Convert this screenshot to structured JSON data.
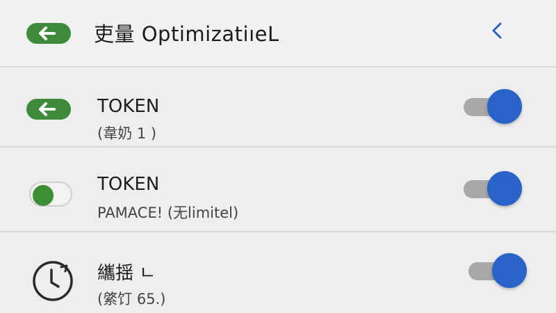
{
  "header": {
    "title": "吏量 OptimizatiıeL",
    "back_icon": "back-arrow-icon",
    "collapse_icon": "chevron-left-icon"
  },
  "rows": [
    {
      "title": "TOKEN",
      "subtitle": "(韋奶 1 )",
      "left_icon": "back-arrow-icon",
      "switch_on": true
    },
    {
      "title": "TOKEN",
      "subtitle": "PAMACE! (无limitel)",
      "left_icon": "toggle-icon",
      "switch_on": true,
      "clear_mark": "✕"
    },
    {
      "title": "纗揺 ㄴ",
      "subtitle": "(綮饤 65.)",
      "left_icon": "clock-icon",
      "switch_on": true
    }
  ],
  "colors": {
    "accent_green": "#3d8b3a",
    "switch_blue": "#2a63c8",
    "track_gray": "#a8a8a8",
    "background": "#eeeeee"
  }
}
